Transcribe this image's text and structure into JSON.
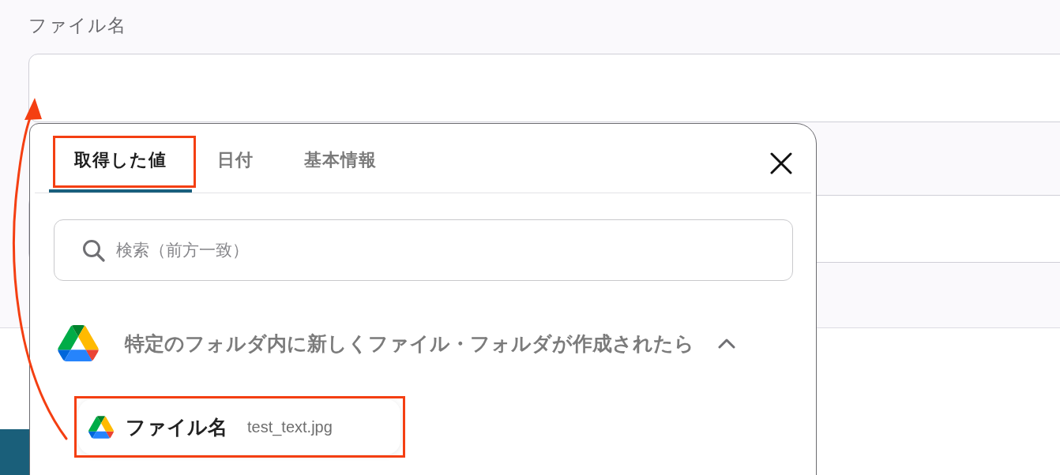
{
  "field": {
    "label": "ファイル名"
  },
  "popup": {
    "tabs": [
      {
        "label": "取得した値",
        "selected": true,
        "highlighted": true
      },
      {
        "label": "日付",
        "selected": false,
        "highlighted": false
      },
      {
        "label": "基本情報",
        "selected": false,
        "highlighted": false
      }
    ],
    "search": {
      "placeholder": "検索（前方一致）"
    },
    "groups": [
      {
        "title": "特定のフォルダ内に新しくファイル・フォルダが作成されたら",
        "expanded": true,
        "items": [
          {
            "name": "ファイル名",
            "value": "test_text.jpg",
            "highlighted": true
          }
        ]
      }
    ]
  }
}
